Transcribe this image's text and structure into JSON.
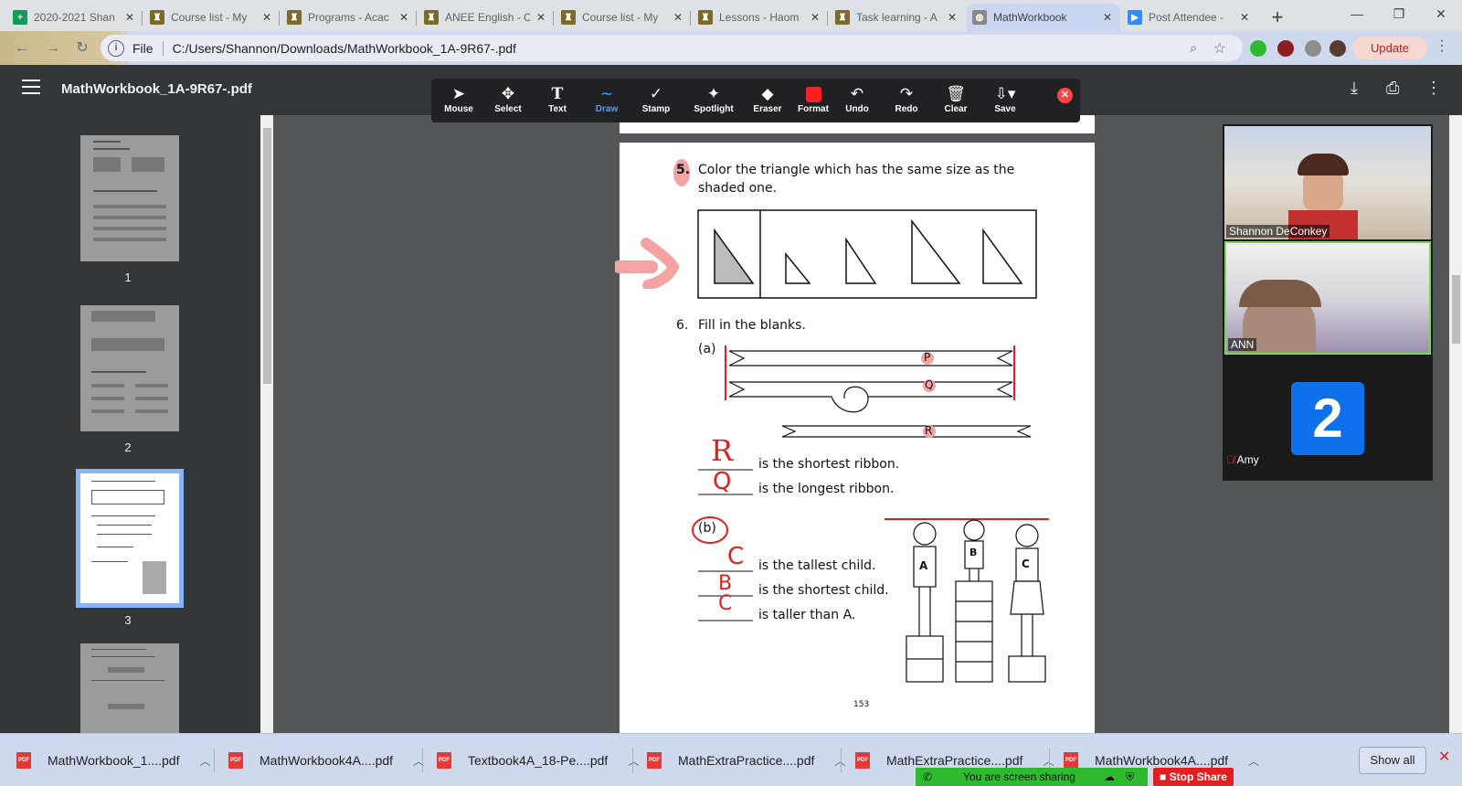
{
  "browser": {
    "tabs": [
      {
        "title": "2020-2021 Shan",
        "favicon": "sheets-icon",
        "color": "#0f9d58"
      },
      {
        "title": "Course list - My",
        "favicon": "school-icon",
        "color": "#7a6b2a"
      },
      {
        "title": "Programs - Acac",
        "favicon": "school-icon",
        "color": "#7a6b2a"
      },
      {
        "title": "ANEE English - C",
        "favicon": "school-icon",
        "color": "#7a6b2a"
      },
      {
        "title": "Course list - My",
        "favicon": "school-icon",
        "color": "#7a6b2a"
      },
      {
        "title": "Lessons - Haom",
        "favicon": "school-icon",
        "color": "#7a6b2a"
      },
      {
        "title": "Task learning - A",
        "favicon": "school-icon",
        "color": "#7a6b2a"
      },
      {
        "title": "MathWorkbook",
        "favicon": "globe-icon",
        "color": "#888888"
      },
      {
        "title": "Post Attendee -",
        "favicon": "zoom-icon",
        "color": "#2d8cff"
      }
    ],
    "active_tab_index": 7,
    "address": {
      "scheme_label": "File",
      "url": "C:/Users/Shannon/Downloads/MathWorkbook_1A-9R67-.pdf"
    },
    "update_label": "Update"
  },
  "viewer": {
    "title": "MathWorkbook_1A-9R67-.pdf",
    "tools": [
      {
        "label": "Mouse",
        "icon": "cursor-icon"
      },
      {
        "label": "Select",
        "icon": "move-icon"
      },
      {
        "label": "Text",
        "icon": "text-icon"
      },
      {
        "label": "Draw",
        "icon": "draw-icon",
        "selected": true
      },
      {
        "label": "Stamp",
        "icon": "check-icon"
      },
      {
        "label": "Spotlight",
        "icon": "wand-icon"
      },
      {
        "label": "Eraser",
        "icon": "eraser-icon"
      },
      {
        "label": "Format",
        "icon": "format-swatch-icon"
      },
      {
        "label": "Undo",
        "icon": "undo-icon"
      },
      {
        "label": "Redo",
        "icon": "redo-icon"
      },
      {
        "label": "Clear",
        "icon": "trash-icon"
      },
      {
        "label": "Save",
        "icon": "save-icon"
      }
    ],
    "format_color": "#ff2020",
    "thumbnails": [
      {
        "page": "1"
      },
      {
        "page": "2"
      },
      {
        "page": "3",
        "selected": true
      },
      {
        "page": ""
      }
    ]
  },
  "document": {
    "q5_number": "5.",
    "q5_text_line1": "Color the triangle which has the same size as the",
    "q5_text_line2": "shaded one.",
    "q6_number": "6.",
    "q6_text": "Fill in the blanks.",
    "part_a": "(a)",
    "part_b": "(b)",
    "ribbon_labels": [
      "P",
      "Q",
      "R"
    ],
    "a_lines": [
      "is the shortest ribbon.",
      "is the longest ribbon."
    ],
    "a_answers": [
      "R",
      "Q"
    ],
    "b_lines": [
      "is the tallest child.",
      "is the shortest child.",
      "is taller than A."
    ],
    "b_answers": [
      "C",
      "B",
      "C"
    ],
    "child_labels": [
      "A",
      "B",
      "C"
    ],
    "page_number": "153",
    "annotation_color": "#e02020"
  },
  "zoom": {
    "participants": [
      {
        "name": "Shannon DeConkey"
      },
      {
        "name": "ANN"
      },
      {
        "name": "Amy",
        "avatar_text": "2",
        "muted": true
      }
    ]
  },
  "downloads": {
    "items": [
      "MathWorkbook_1....pdf",
      "MathWorkbook4A....pdf",
      "Textbook4A_18-Pe....pdf",
      "MathExtraPractice....pdf",
      "MathExtraPractice....pdf",
      "MathWorkbook4A....pdf"
    ],
    "show_all_label": "Show all"
  },
  "screenshare": {
    "status": "You are screen sharing",
    "stop_label": "Stop Share"
  }
}
